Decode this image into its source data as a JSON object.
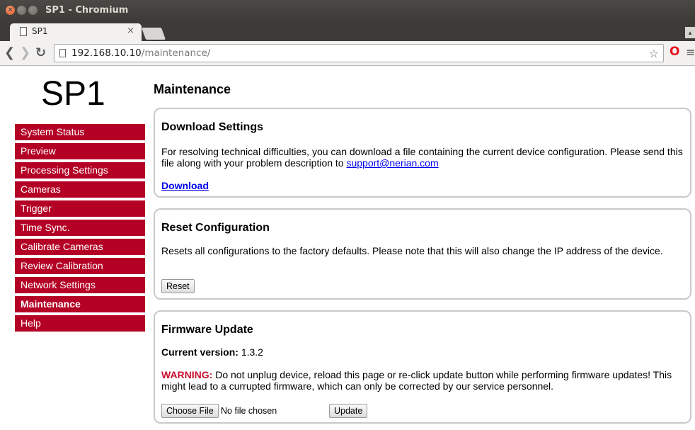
{
  "window": {
    "title": "SP1 - Chromium"
  },
  "tab": {
    "title": "SP1",
    "close": "×"
  },
  "toolbar": {
    "url_host": "192.168.10.10",
    "url_path": "/maintenance/"
  },
  "logo": "SP1",
  "nav": {
    "items": [
      {
        "label": "System Status"
      },
      {
        "label": "Preview"
      },
      {
        "label": "Processing Settings"
      },
      {
        "label": "Cameras"
      },
      {
        "label": "Trigger"
      },
      {
        "label": "Time Sync."
      },
      {
        "label": "Calibrate Cameras"
      },
      {
        "label": "Review Calibration"
      },
      {
        "label": "Network Settings"
      },
      {
        "label": "Maintenance",
        "active": true
      },
      {
        "label": "Help"
      }
    ]
  },
  "main": {
    "title": "Maintenance",
    "download": {
      "heading": "Download Settings",
      "text": "For resolving technical difficulties, you can download a file containing the current device configuration. Please send this file along with your problem description to",
      "email": "support@nerian.com",
      "link": "Download"
    },
    "reset": {
      "heading": "Reset Configuration",
      "text": "Resets all configurations to the factory defaults. Please note that this will also change the IP address of the device.",
      "button": "Reset"
    },
    "firmware": {
      "heading": "Firmware Update",
      "version_label": "Current version:",
      "version": "1.3.2",
      "warning_label": "WARNING:",
      "warning_text": "Do not unplug device, reload this page or re-click update button while performing firmware updates! This might lead to a currupted firmware, which can only be corrected by our service personnel.",
      "choose_button": "Choose File",
      "file_status": "No file chosen",
      "update_button": "Update"
    }
  },
  "colors": {
    "nav_bg": "#b40025",
    "warning": "#c8102e",
    "link": "#0000ee"
  }
}
